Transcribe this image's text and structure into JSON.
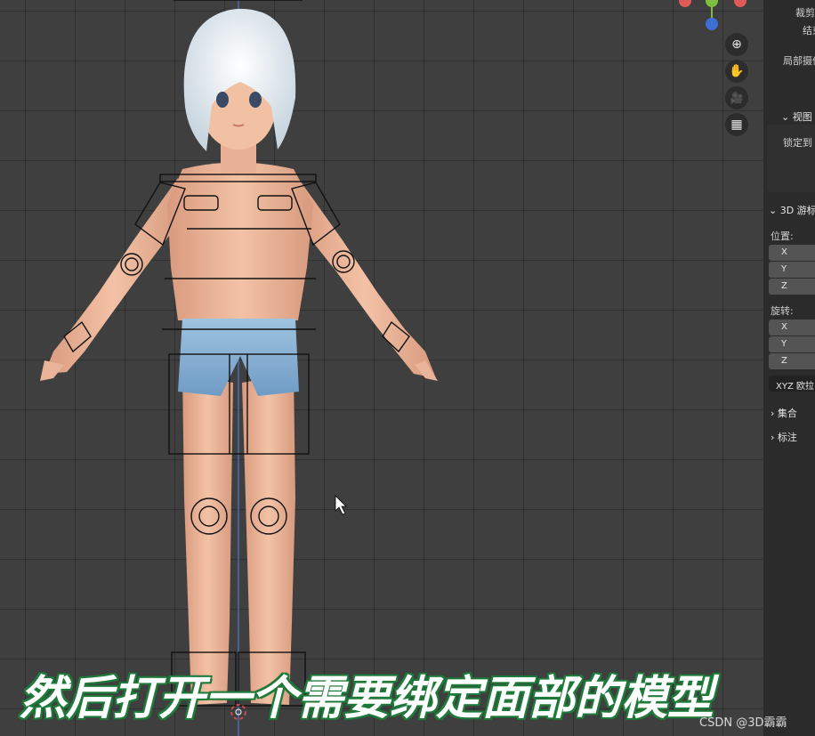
{
  "viewport": {
    "nav_buttons": [
      {
        "name": "zoom-icon",
        "glyph": "⊕"
      },
      {
        "name": "hand-pan-icon",
        "glyph": "✋"
      },
      {
        "name": "camera-icon",
        "glyph": "🎥"
      },
      {
        "name": "grid-ortho-icon",
        "glyph": "▦"
      }
    ],
    "gizmo_colors": {
      "x": "#e05a5a",
      "y": "#7fbf3f",
      "z": "#3d6fd6"
    }
  },
  "npanel": {
    "clip_label": "裁剪",
    "end_label": "结束",
    "local_camera_label": "局部摄像",
    "view_section": "视图",
    "lock_label": "锁定到",
    "cursor_section": "3D 游标",
    "location_label": "位置:",
    "rotation_label": "旋转:",
    "location_axes": [
      "X",
      "Y",
      "Z"
    ],
    "rotation_axes": [
      "X",
      "Y",
      "Z"
    ],
    "rotation_mode": "XYZ 欧拉",
    "collection_section": "集合",
    "annotation_section": "标注"
  },
  "subtitle": "然后打开一个需要绑定面部的模型",
  "watermark": "CSDN @3D霸霸"
}
